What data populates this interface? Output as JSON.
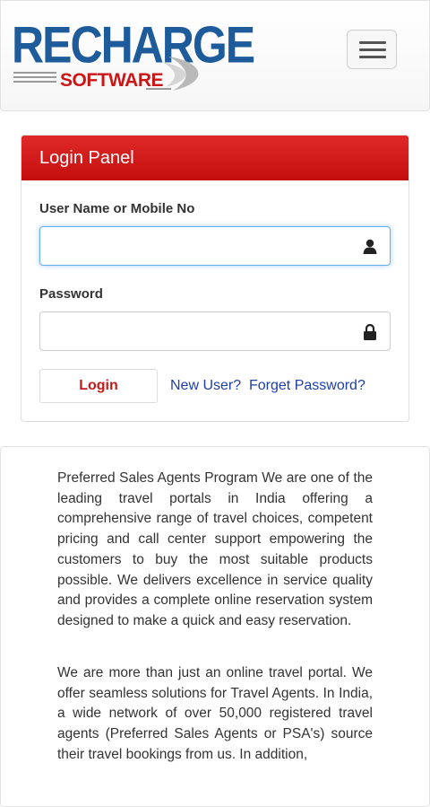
{
  "header": {
    "logo_top": "RECHARGE",
    "logo_bottom": "SOFTWARE",
    "menu_icon": "hamburger-menu-icon"
  },
  "login_panel": {
    "title": "Login Panel",
    "username_label": "User Name or Mobile No",
    "username_value": "",
    "username_icon": "user-icon",
    "password_label": "Password",
    "password_value": "",
    "password_icon": "lock-icon",
    "login_button": "Login",
    "new_user_link": "New User?",
    "forget_password_link": "Forget Password?"
  },
  "content": {
    "paragraph1": "Preferred Sales Agents Program We are one of the leading travel portals in India offering a comprehensive range of travel choices, competent pricing and call center support empowering the customers to buy the most suitable products possible. We delivers excellence in service quality and provides a complete online reservation system designed to make a quick and easy reservation.",
    "paragraph2": "We are more than just an online travel portal. We offer seamless solutions for Travel Agents. In India, a wide network of over 50,000 registered travel agents (Preferred Sales Agents or PSA's) source their travel bookings from us. In addition,"
  },
  "colors": {
    "brand_blue": "#1d5b9b",
    "brand_red": "#cc1515",
    "panel_header": "#d41919",
    "link": "#1d3fa8"
  }
}
